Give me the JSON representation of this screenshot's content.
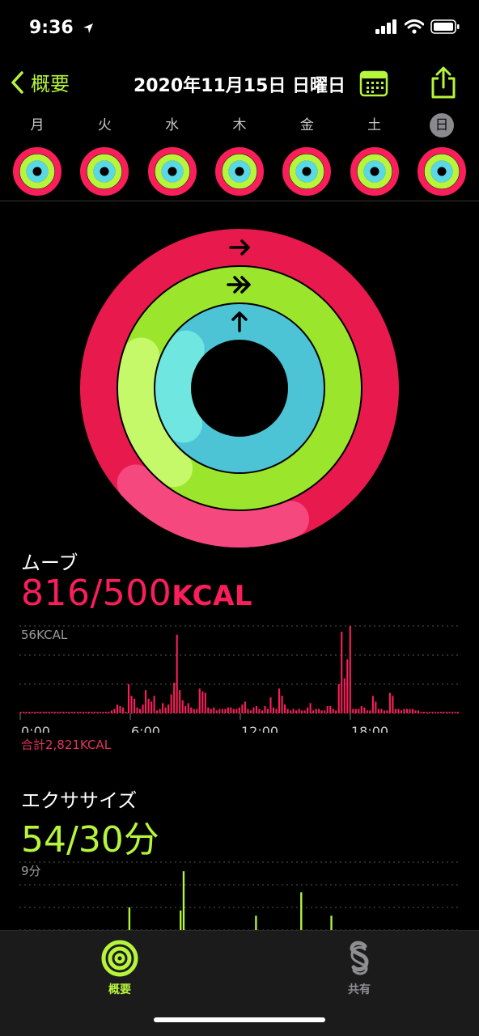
{
  "status": {
    "time": "9:36"
  },
  "nav": {
    "back_label": "概要",
    "title": "2020年11月15日 日曜日"
  },
  "week": [
    {
      "label": "月",
      "selected": false
    },
    {
      "label": "火",
      "selected": false
    },
    {
      "label": "水",
      "selected": false
    },
    {
      "label": "木",
      "selected": false
    },
    {
      "label": "金",
      "selected": false
    },
    {
      "label": "土",
      "selected": false
    },
    {
      "label": "日",
      "selected": true
    }
  ],
  "rings": {
    "move_fraction": 1.632,
    "exercise_fraction": 1.8,
    "stand_fraction": 0.85,
    "colors": {
      "move": "#fa1e5a",
      "exercise": "#b6f53c",
      "stand": "#5ad8e6"
    }
  },
  "move": {
    "title": "ムーブ",
    "value": "816/500",
    "unit": "KCAL",
    "total": "合計2,821KCAL"
  },
  "exercise": {
    "title": "エクササイズ",
    "value": "54/30分"
  },
  "chart_data": [
    {
      "type": "bar",
      "title": "ムーブ",
      "ylabel": "56KCAL",
      "x_ticks": [
        "0:00",
        "6:00",
        "12:00",
        "18:00"
      ],
      "ylim": [
        0,
        60
      ],
      "values": [
        1,
        1,
        1,
        1,
        1,
        1,
        1,
        1,
        1,
        1,
        1,
        1,
        1,
        1,
        1,
        1,
        1,
        1,
        1,
        1,
        1,
        1,
        1,
        1,
        1,
        1,
        1,
        1,
        1,
        1,
        1,
        1,
        2,
        3,
        6,
        5,
        4,
        1,
        20,
        12,
        10,
        4,
        3,
        6,
        16,
        10,
        8,
        12,
        2,
        3,
        7,
        4,
        6,
        13,
        21,
        54,
        16,
        9,
        5,
        7,
        4,
        3,
        3,
        17,
        15,
        14,
        4,
        3,
        4,
        2,
        3,
        3,
        3,
        4,
        4,
        3,
        3,
        4,
        6,
        8,
        3,
        2,
        4,
        5,
        3,
        2,
        5,
        3,
        11,
        4,
        3,
        17,
        12,
        6,
        3,
        2,
        3,
        2,
        3,
        2,
        2,
        4,
        7,
        2,
        3,
        3,
        2,
        2,
        5,
        5,
        3,
        2,
        20,
        56,
        24,
        37,
        60,
        3,
        3,
        3,
        5,
        4,
        2,
        2,
        12,
        8,
        3,
        3,
        2,
        2,
        14,
        12,
        3,
        3,
        2,
        3,
        3,
        3,
        3,
        2,
        2,
        1,
        1,
        1,
        1,
        1,
        1,
        1,
        1,
        1,
        1,
        1,
        1,
        1,
        1
      ],
      "color": "#fa1e5a"
    },
    {
      "type": "bar",
      "title": "エクササイズ",
      "ylabel": "9分",
      "ylim": [
        0,
        9
      ],
      "values": [
        0,
        0,
        0,
        0,
        0,
        0,
        0,
        0,
        0,
        0,
        0,
        0,
        0,
        0,
        0,
        0,
        0,
        0,
        0,
        0,
        0,
        0,
        0,
        0,
        0,
        0,
        0,
        0,
        0,
        0,
        0,
        0,
        0,
        0,
        0,
        0,
        0,
        0,
        0,
        0,
        0,
        0,
        0,
        0,
        0,
        0,
        0,
        0,
        0,
        0,
        0,
        0,
        0,
        0,
        0,
        0,
        0,
        0,
        0,
        0,
        0,
        0,
        0,
        0,
        0,
        0,
        0,
        0,
        0,
        0,
        0,
        0,
        0,
        0,
        0,
        0,
        0,
        0,
        0,
        0,
        0,
        0,
        0,
        0,
        0,
        0,
        0,
        0,
        0,
        0,
        0,
        0,
        0,
        0,
        0,
        0,
        0,
        0,
        0,
        0,
        0,
        0,
        0,
        0,
        0,
        0,
        0,
        0,
        0,
        0,
        0,
        0,
        0,
        0,
        0,
        0,
        0,
        0,
        0,
        0,
        0,
        0,
        0,
        0,
        0,
        0,
        0,
        0,
        0,
        0,
        0,
        0,
        0,
        0,
        0,
        0,
        0,
        0,
        0,
        0,
        0,
        0,
        0,
        0,
        0,
        0
      ],
      "bars": [
        [
          36,
          3.0
        ],
        [
          53,
          2.6
        ],
        [
          54,
          7.8
        ],
        [
          78,
          1.9
        ],
        [
          93,
          5.0
        ],
        [
          103,
          1.9
        ]
      ],
      "color": "#b6f53c"
    }
  ],
  "tabs": [
    {
      "label": "概要",
      "active": true
    },
    {
      "label": "共有",
      "active": false
    }
  ]
}
